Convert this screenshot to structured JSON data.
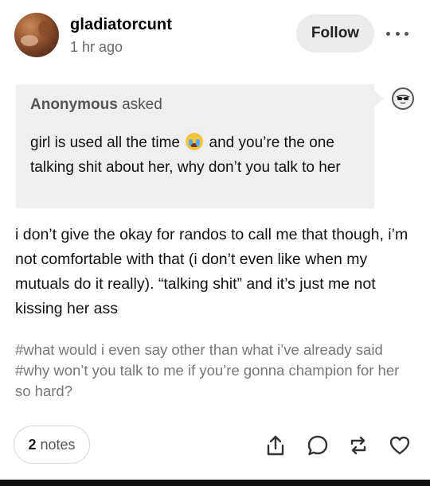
{
  "post": {
    "username": "gladiatorcunt",
    "timestamp": "1 hr ago",
    "follow_label": "Follow"
  },
  "ask": {
    "asker": "Anonymous",
    "asked_label": "asked",
    "text_before_emoji": "girl is used all the time",
    "emoji": "crying-face-emoji",
    "text_after_emoji": "and you’re the one talking shit about her, why don’t you talk to her"
  },
  "answer": {
    "text": "i don’t give the okay for randos to call me that though, i’m not comfortable with that (i don’t even like when my mutuals do it really). “talking shit” and it’s just me not kissing her ass"
  },
  "tags": [
    "#what would i even say other than what i’ve already said",
    "#why won’t you talk to me if you’re gonna champion for her so hard?"
  ],
  "footer": {
    "notes_count": "2",
    "notes_label": "notes",
    "actions": [
      "share-icon",
      "reply-icon",
      "reblog-icon",
      "like-icon"
    ]
  }
}
